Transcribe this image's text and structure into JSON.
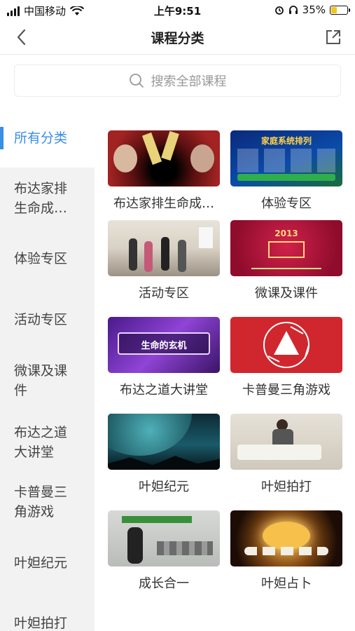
{
  "status": {
    "carrier": "中国移动",
    "time": "上午9:51",
    "battery": "35%"
  },
  "nav": {
    "title": "课程分类"
  },
  "search": {
    "placeholder": "搜索全部课程"
  },
  "sidebar": {
    "items": [
      {
        "label": "所有分类"
      },
      {
        "label": "布达家排生命成…"
      },
      {
        "label": "体验专区"
      },
      {
        "label": "活动专区"
      },
      {
        "label": "微课及课件"
      },
      {
        "label": "布达之道大讲堂"
      },
      {
        "label": "卡普曼三角游戏"
      },
      {
        "label": "叶妲纪元"
      },
      {
        "label": "叶妲拍打"
      }
    ]
  },
  "cards": [
    {
      "label": "布达家排生命成…",
      "thumb_text": ""
    },
    {
      "label": "体验专区",
      "thumb_text": "家庭系统排列"
    },
    {
      "label": "活动专区",
      "thumb_text": ""
    },
    {
      "label": "微课及课件",
      "thumb_text": "2013"
    },
    {
      "label": "布达之道大讲堂",
      "thumb_text": "生命的玄机"
    },
    {
      "label": "卡普曼三角游戏",
      "thumb_text": ""
    },
    {
      "label": "叶妲纪元",
      "thumb_text": ""
    },
    {
      "label": "叶妲拍打",
      "thumb_text": ""
    },
    {
      "label": "成长合一",
      "thumb_text": ""
    },
    {
      "label": "叶妲占卜",
      "thumb_text": ""
    }
  ],
  "colors": {
    "accent": "#3a8ee6"
  }
}
